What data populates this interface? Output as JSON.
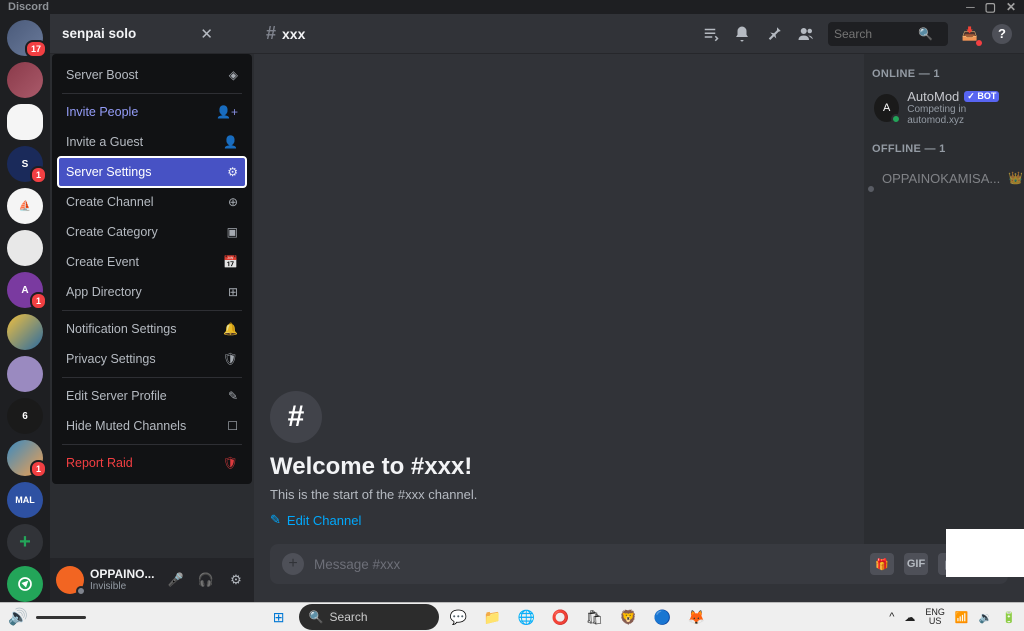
{
  "titlebar": {
    "app": "Discord"
  },
  "rail": {
    "servers": [
      {
        "badge": "17",
        "color": "#4a5a7a"
      },
      {
        "badge": "",
        "color": "#8a3a4a"
      },
      {
        "badge": "",
        "color": "#f5f5f5",
        "sel": true
      },
      {
        "badge": "1",
        "color": "#1a2a5a",
        "label": "S"
      },
      {
        "badge": "",
        "color": "#f5f5f5"
      },
      {
        "badge": "",
        "color": "#e8e8e8"
      },
      {
        "badge": "1",
        "color": "#7a3aa0",
        "label": "A"
      },
      {
        "badge": "",
        "color": "#2a6aa0"
      },
      {
        "badge": "",
        "color": "#9a8ac0"
      },
      {
        "badge": "",
        "color": "#2a2a2a",
        "label": "6"
      },
      {
        "badge": "1",
        "color": "#3a8ac0"
      },
      {
        "badge": "",
        "color": "#2e51a2",
        "label": "MAL"
      }
    ]
  },
  "header": {
    "server_name": "senpai solo",
    "channel_name": "xxx",
    "search_placeholder": "Search"
  },
  "menu": {
    "boost": "Server Boost",
    "invite": "Invite People",
    "guest": "Invite a Guest",
    "settings": "Server Settings",
    "create_channel": "Create Channel",
    "create_category": "Create Category",
    "create_event": "Create Event",
    "app_dir": "App Directory",
    "notif": "Notification Settings",
    "privacy": "Privacy Settings",
    "edit_profile": "Edit Server Profile",
    "hide_muted": "Hide Muted Channels",
    "report": "Report Raid"
  },
  "welcome": {
    "title": "Welcome to #xxx!",
    "sub": "This is the start of the #xxx channel.",
    "edit": "Edit Channel"
  },
  "composer": {
    "placeholder": "Message #xxx",
    "gif": "GIF"
  },
  "members": {
    "online_hdr": "ONLINE — 1",
    "bot_name": "AutoMod",
    "bot_tag": "✓ BOT",
    "bot_sub": "Competing in automod.xyz",
    "offline_hdr": "OFFLINE — 1",
    "user1": "OPPAINOKAMISA..."
  },
  "userpanel": {
    "name": "OPPAINO...",
    "status": "Invisible"
  },
  "taskbar": {
    "search": "Search",
    "lang1": "ENG",
    "lang2": "US"
  }
}
